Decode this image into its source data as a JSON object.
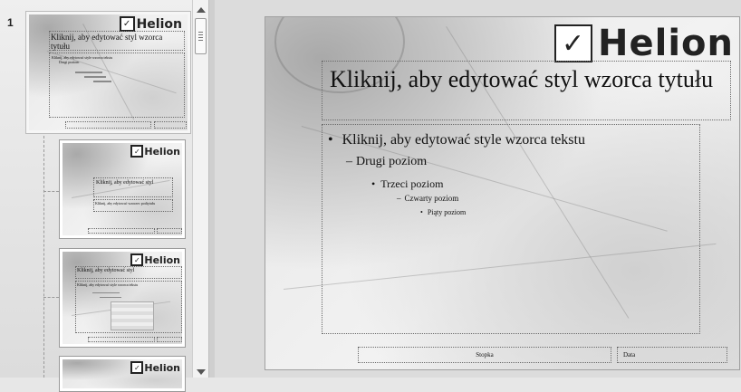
{
  "slide_panel": {
    "selected_slide_number": "1",
    "thumbnails": [
      {
        "title": "Kliknij, aby edytować styl wzorca tytułu",
        "body": "Kliknij, aby edytować style wzorca tekstu",
        "level2": "Drugi poziom"
      },
      {
        "title": "Kliknij, aby edytować styl",
        "body": "Kliknij, aby edytować wzorzec podtytułu"
      },
      {
        "title": "Kliknij, aby edytować styl",
        "body": "Kliknij, aby edytować style wzorca tekstu"
      },
      {
        "title": "",
        "body": ""
      }
    ]
  },
  "logo": {
    "icon_text": "✓",
    "brand_text": "Helion"
  },
  "main_slide": {
    "title": "Kliknij, aby edytować styl wzorca tytułu",
    "bullets": [
      {
        "level": 1,
        "marker": "•",
        "text": "Kliknij, aby edytować style wzorca tekstu"
      },
      {
        "level": 2,
        "marker": "–",
        "text": "Drugi poziom"
      },
      {
        "level": 3,
        "marker": "•",
        "text": "Trzeci poziom"
      },
      {
        "level": 4,
        "marker": "–",
        "text": "Czwarty poziom"
      },
      {
        "level": 5,
        "marker": "•",
        "text": "Piąty poziom"
      }
    ],
    "footer": "Stopka",
    "date": "Data"
  }
}
